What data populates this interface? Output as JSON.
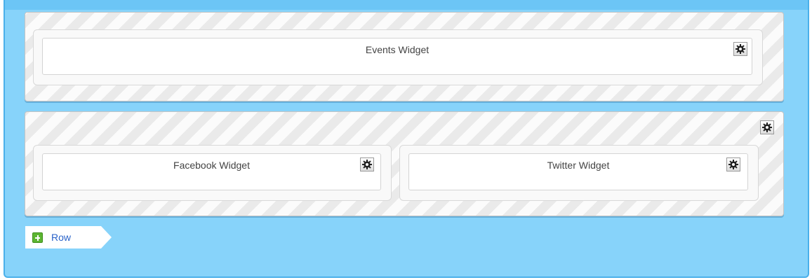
{
  "layout_editor": {
    "rows": [
      {
        "widgets": [
          {
            "title": "Events Widget",
            "settings_icon": "gear-icon"
          }
        ]
      },
      {
        "settings_icon": "gear-icon",
        "widgets": [
          {
            "title": "Facebook Widget",
            "settings_icon": "gear-icon"
          },
          {
            "title": "Twitter Widget",
            "settings_icon": "gear-icon"
          }
        ]
      }
    ],
    "add_row": {
      "label": "Row",
      "icon": "plus-icon"
    }
  },
  "colors": {
    "canvas_background": "#87d3fa",
    "canvas_border": "#4ab0ea",
    "stripe_dark": "#eaeaea",
    "stripe_light": "#fbfbfb",
    "add_icon": "#5cb531",
    "link_text": "#2a63c9"
  }
}
